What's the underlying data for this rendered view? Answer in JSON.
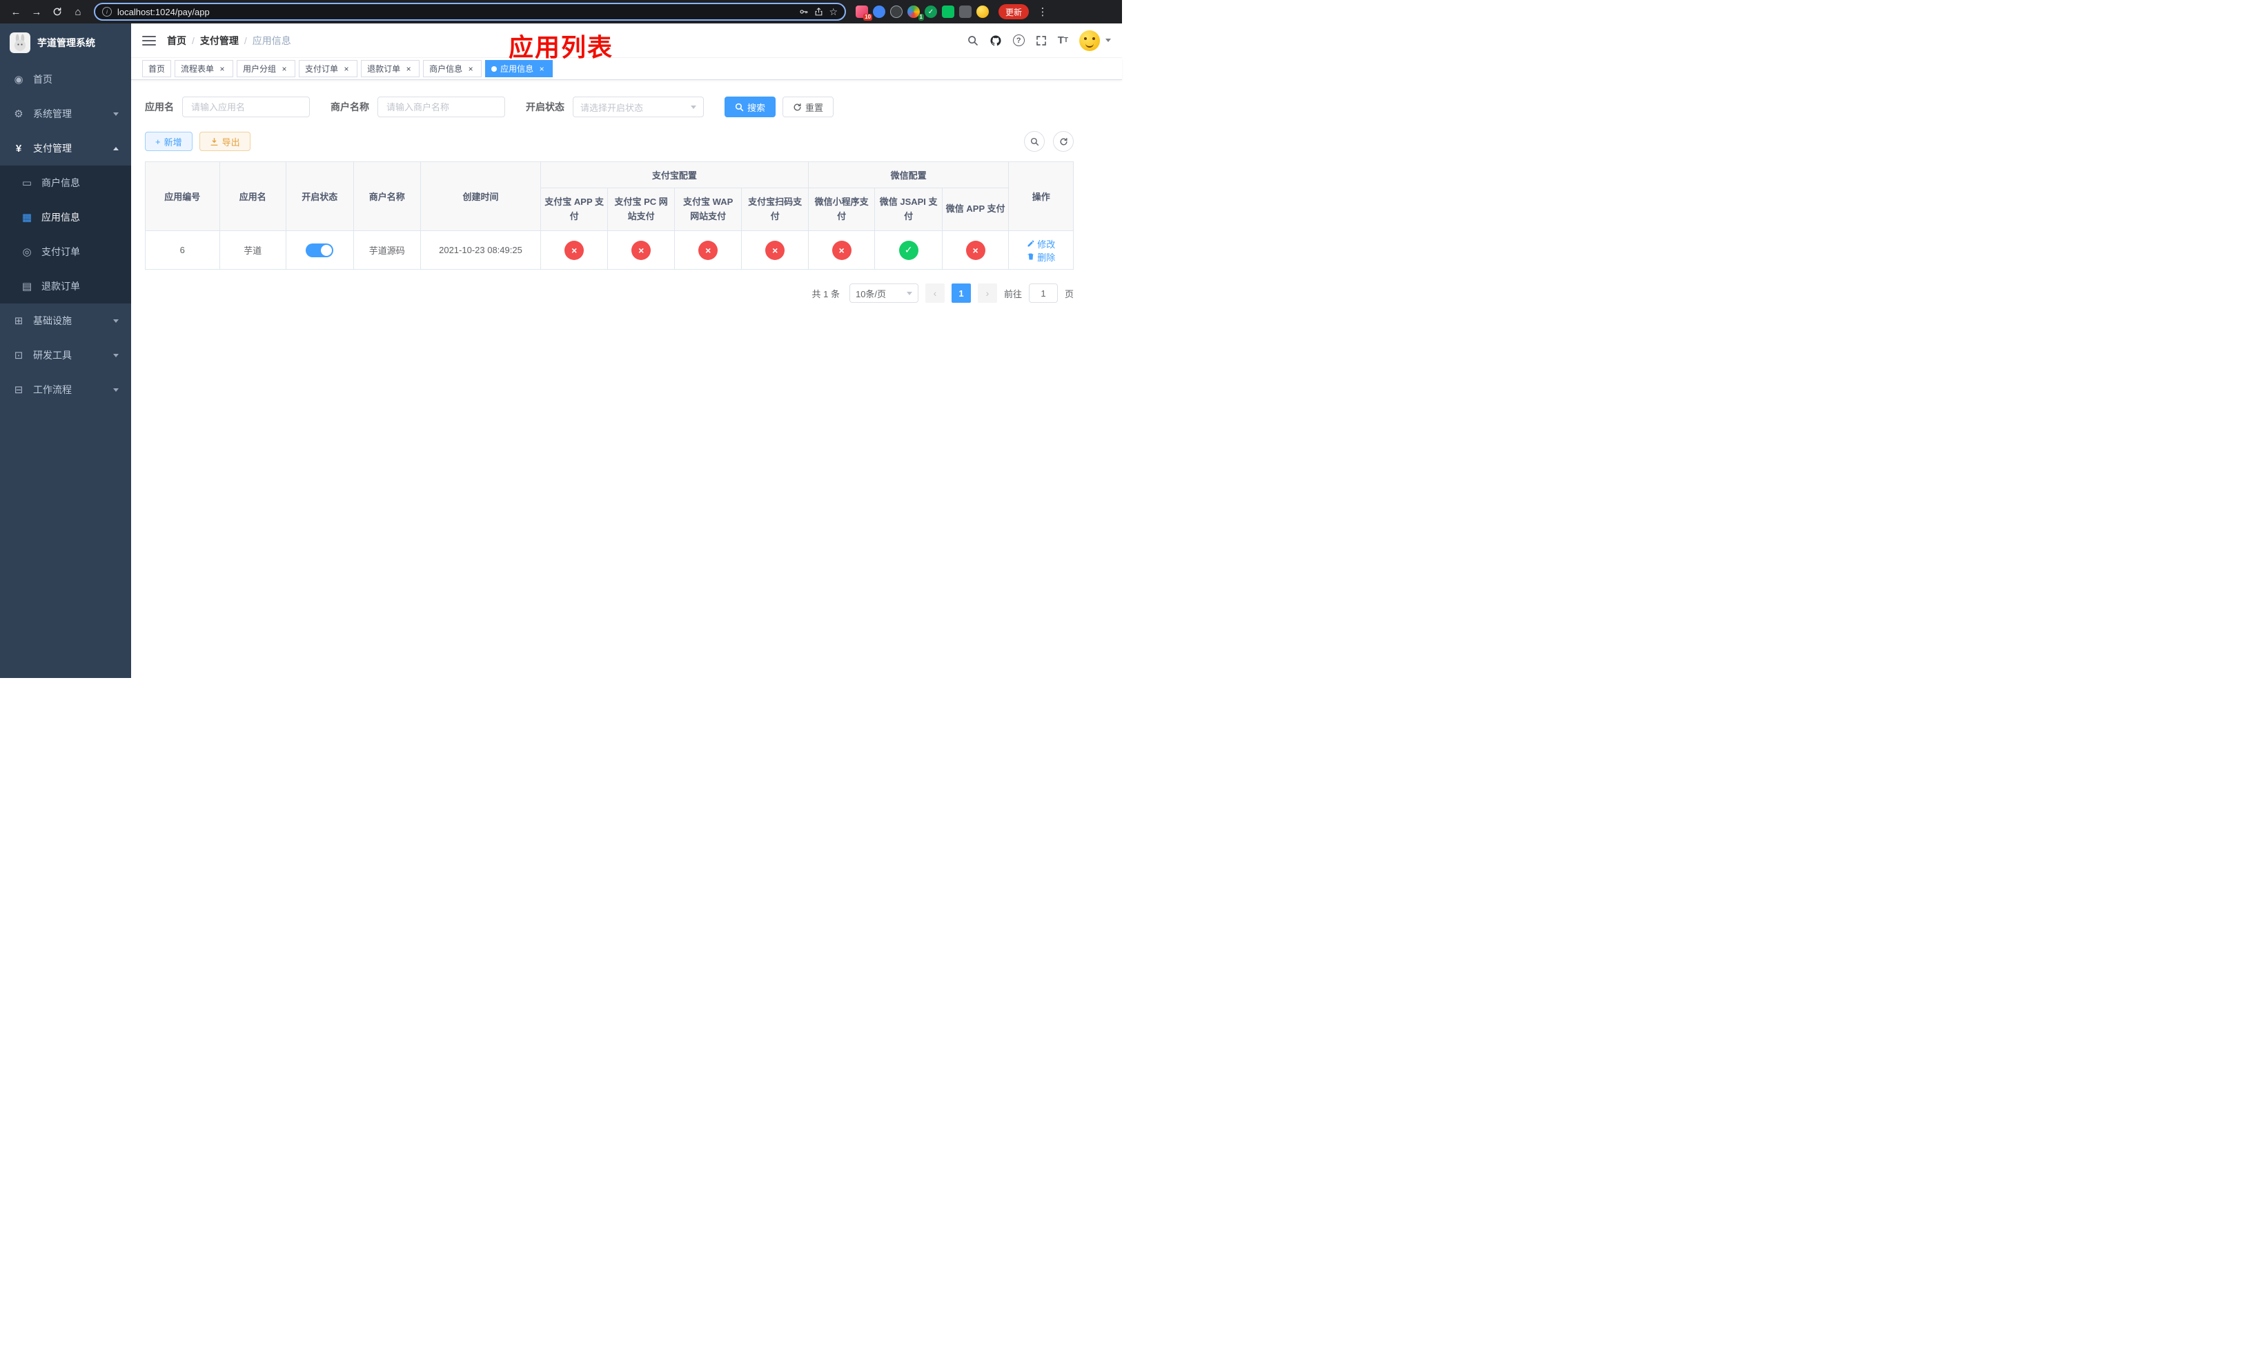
{
  "colors": {
    "primary": "#409eff",
    "success": "#13ce66",
    "danger": "#f34d4d",
    "warning": "#e6a23c",
    "sidebar_bg": "#304156",
    "submenu_bg": "#1f2d3d",
    "annotation_red": "#f20d00"
  },
  "browser": {
    "url": "localhost:1024/pay/app",
    "update_label": "更新",
    "ext_badge_first": "10",
    "ext_badge_second": "1"
  },
  "sidebar": {
    "title": "芋道管理系统",
    "items": {
      "home": "首页",
      "system": "系统管理",
      "payment": "支付管理",
      "merchant": "商户信息",
      "app": "应用信息",
      "pay_order": "支付订单",
      "refund_order": "退款订单",
      "infra": "基础设施",
      "devtools": "研发工具",
      "workflow": "工作流程"
    }
  },
  "navbar": {
    "breadcrumb": {
      "home": "首页",
      "section": "支付管理",
      "page": "应用信息"
    }
  },
  "annotation": "应用列表",
  "tabs": {
    "t0": "首页",
    "t1": "流程表单",
    "t2": "用户分组",
    "t3": "支付订单",
    "t4": "退款订单",
    "t5": "商户信息",
    "t6": "应用信息"
  },
  "filters": {
    "app_name_label": "应用名",
    "app_name_placeholder": "请输入应用名",
    "merchant_label": "商户名称",
    "merchant_placeholder": "请输入商户名称",
    "status_label": "开启状态",
    "status_placeholder": "请选择开启状态",
    "search_label": "搜索",
    "reset_label": "重置"
  },
  "toolbar": {
    "add_label": "新增",
    "export_label": "导出"
  },
  "table": {
    "headers": {
      "app_id": "应用编号",
      "app_name": "应用名",
      "status": "开启状态",
      "merchant_name": "商户名称",
      "create_time": "创建时间",
      "alipay_group": "支付宝配置",
      "wechat_group": "微信配置",
      "alipay_app": "支付宝 APP 支付",
      "alipay_pc": "支付宝 PC 网站支付",
      "alipay_wap": "支付宝 WAP 网站支付",
      "alipay_qr": "支付宝扫码支付",
      "wx_mini": "微信小程序支付",
      "wx_jsapi": "微信 JSAPI 支付",
      "wx_app": "微信 APP 支付",
      "actions": "操作"
    },
    "row": {
      "app_id": "6",
      "app_name": "芋道",
      "enabled": true,
      "merchant_name": "芋道源码",
      "create_time": "2021-10-23 08:49:25",
      "alipay_app": false,
      "alipay_pc": false,
      "alipay_wap": false,
      "alipay_qr": false,
      "wx_mini": false,
      "wx_jsapi": true,
      "wx_app": false,
      "edit_label": "修改",
      "delete_label": "删除"
    }
  },
  "pagination": {
    "total": "共 1 条",
    "page_size": "10条/页",
    "page": "1",
    "goto_label": "前往",
    "goto_value": "1",
    "unit_label": "页"
  }
}
